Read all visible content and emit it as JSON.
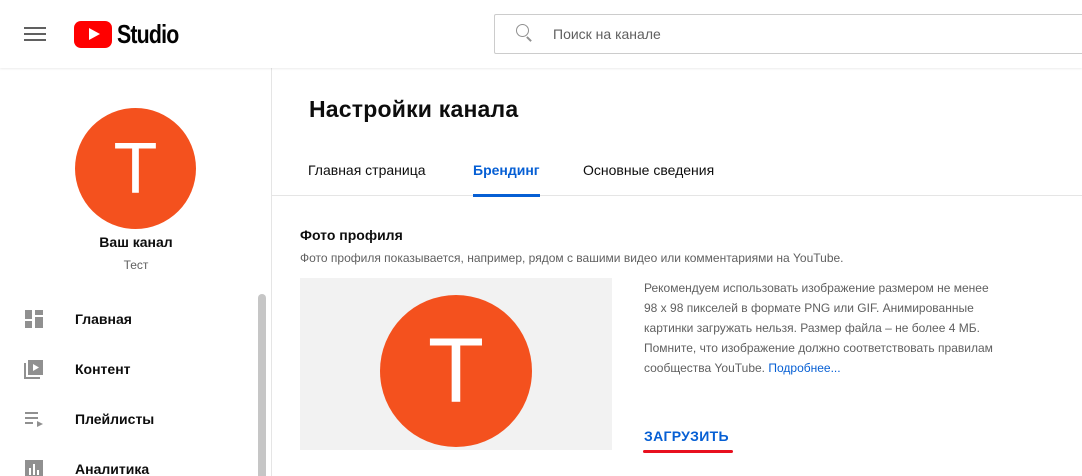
{
  "header": {
    "logo_text": "Studio",
    "search_placeholder": "Поиск на канале"
  },
  "sidebar": {
    "avatar_letter": "T",
    "channel_title": "Ваш канал",
    "channel_subtitle": "Тест",
    "items": [
      {
        "label": "Главная",
        "icon": "dashboard-icon"
      },
      {
        "label": "Контент",
        "icon": "content-icon"
      },
      {
        "label": "Плейлисты",
        "icon": "playlists-icon"
      },
      {
        "label": "Аналитика",
        "icon": "analytics-icon"
      }
    ]
  },
  "main": {
    "page_title": "Настройки канала",
    "tabs": [
      {
        "label": "Главная страница",
        "active": false
      },
      {
        "label": "Брендинг",
        "active": true
      },
      {
        "label": "Основные сведения",
        "active": false
      }
    ],
    "profile_photo": {
      "title": "Фото профиля",
      "description": "Фото профиля показывается, например, рядом с вашими видео или комментариями на YouTube.",
      "avatar_letter": "T",
      "recommendation": "Рекомендуем использовать изображение размером не менее 98 х 98 пикселей в формате PNG или GIF. Анимированные картинки загружать нельзя. Размер файла – не более 4 МБ. Помните, что изображение должно соответствовать правилам сообщества YouTube.",
      "more_link": "Подробнее...",
      "upload_label": "ЗАГРУЗИТЬ"
    }
  },
  "colors": {
    "accent": "#065fd4",
    "avatar": "#f4511e",
    "youtube_red": "#ff0000",
    "annotation_underline": "#e8101f"
  }
}
